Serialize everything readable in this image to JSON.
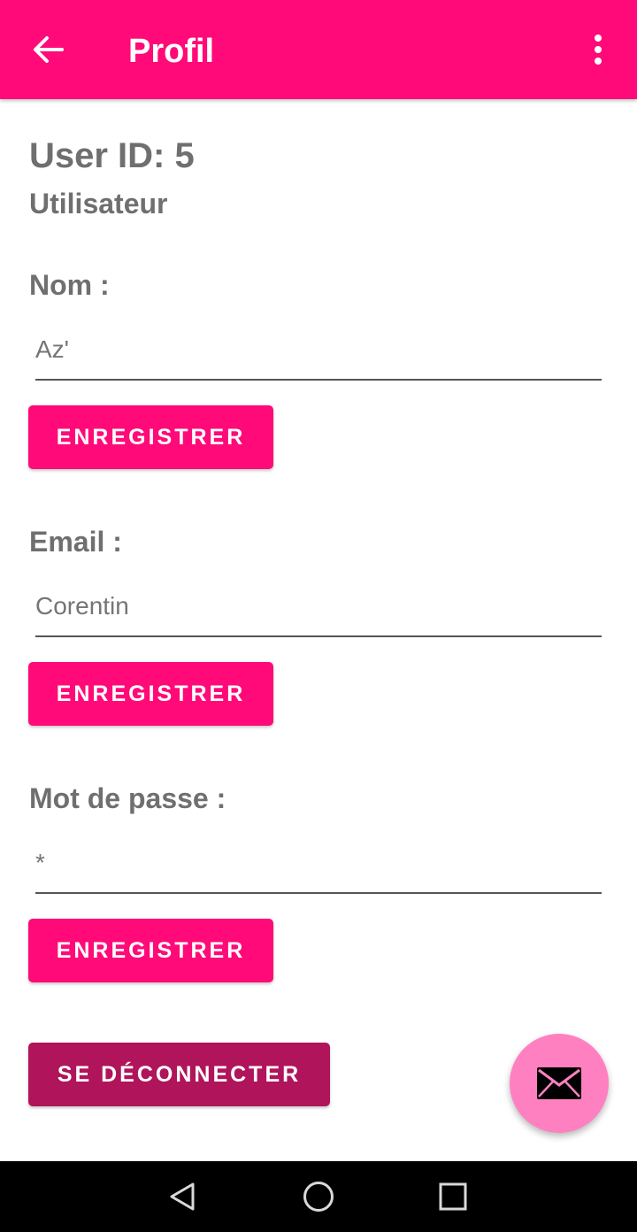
{
  "appbar": {
    "title": "Profil",
    "back_icon": "arrow-left-icon",
    "menu_icon": "more-vertical-icon",
    "color": "#FF0A78"
  },
  "profile": {
    "user_id_text": "User ID: 5",
    "role": "Utilisateur"
  },
  "sections": {
    "name": {
      "label": "Nom :",
      "placeholder": "Az'",
      "save_label": "ENREGISTRER"
    },
    "email": {
      "label": "Email :",
      "placeholder": "Corentin",
      "save_label": "ENREGISTRER"
    },
    "password": {
      "label": "Mot de passe :",
      "placeholder": "*",
      "save_label": "ENREGISTRER"
    }
  },
  "logout": {
    "label": "SE DÉCONNECTER",
    "color": "#B0145A"
  },
  "fab": {
    "icon": "mail-icon",
    "color": "#FF80C0"
  },
  "navbar": {
    "back_icon": "nav-back-icon",
    "home_icon": "nav-home-icon",
    "recents_icon": "nav-recents-icon"
  }
}
